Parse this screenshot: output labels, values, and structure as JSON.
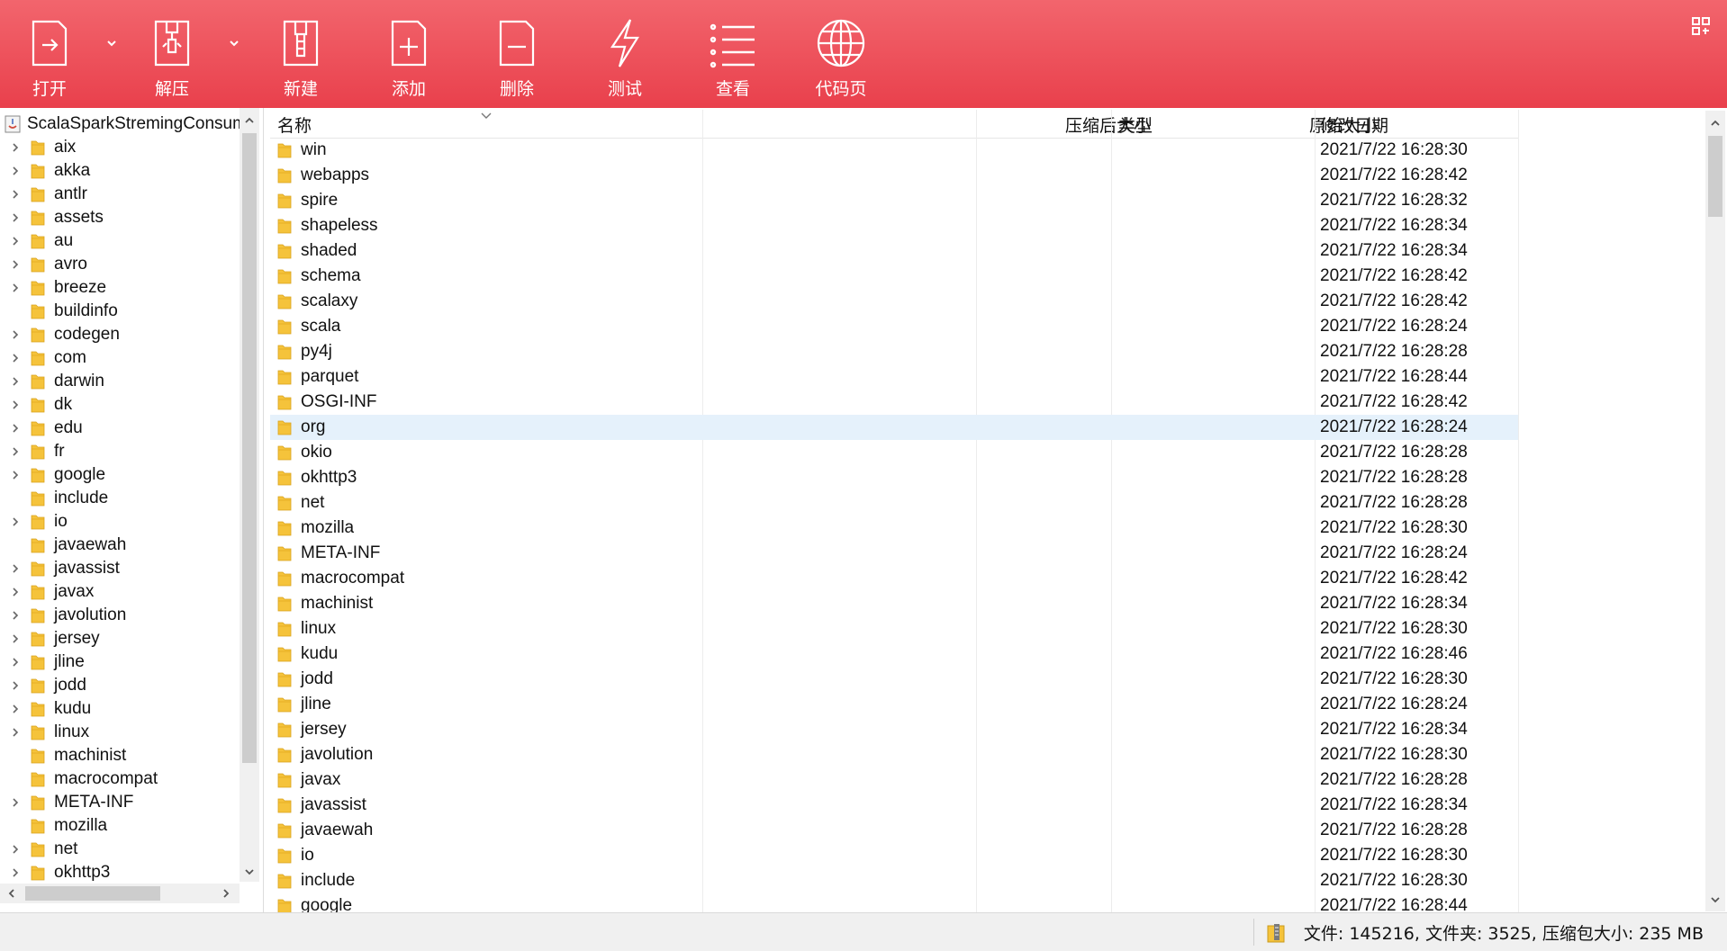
{
  "toolbar": {
    "buttons": [
      {
        "label": "打开",
        "icon": "open-icon"
      },
      {
        "label": "解压",
        "icon": "extract-icon"
      },
      {
        "label": "新建",
        "icon": "new-archive-icon"
      },
      {
        "label": "添加",
        "icon": "add-file-icon"
      },
      {
        "label": "删除",
        "icon": "delete-file-icon"
      },
      {
        "label": "测试",
        "icon": "test-icon"
      },
      {
        "label": "查看",
        "icon": "view-list-icon"
      },
      {
        "label": "代码页",
        "icon": "codepage-globe-icon"
      }
    ],
    "colors": {
      "gradient_top": "#f2656d",
      "gradient_bottom": "#e9404c"
    }
  },
  "tree": {
    "root_label": "ScalaSparkStremingConsumer",
    "items": [
      {
        "label": "aix",
        "expandable": true
      },
      {
        "label": "akka",
        "expandable": true
      },
      {
        "label": "antlr",
        "expandable": true
      },
      {
        "label": "assets",
        "expandable": true
      },
      {
        "label": "au",
        "expandable": true
      },
      {
        "label": "avro",
        "expandable": true
      },
      {
        "label": "breeze",
        "expandable": true
      },
      {
        "label": "buildinfo",
        "expandable": false
      },
      {
        "label": "codegen",
        "expandable": true
      },
      {
        "label": "com",
        "expandable": true
      },
      {
        "label": "darwin",
        "expandable": true
      },
      {
        "label": "dk",
        "expandable": true
      },
      {
        "label": "edu",
        "expandable": true
      },
      {
        "label": "fr",
        "expandable": true
      },
      {
        "label": "google",
        "expandable": true
      },
      {
        "label": "include",
        "expandable": false
      },
      {
        "label": "io",
        "expandable": true
      },
      {
        "label": "javaewah",
        "expandable": false
      },
      {
        "label": "javassist",
        "expandable": true
      },
      {
        "label": "javax",
        "expandable": true
      },
      {
        "label": "javolution",
        "expandable": true
      },
      {
        "label": "jersey",
        "expandable": true
      },
      {
        "label": "jline",
        "expandable": true
      },
      {
        "label": "jodd",
        "expandable": true
      },
      {
        "label": "kudu",
        "expandable": true
      },
      {
        "label": "linux",
        "expandable": true
      },
      {
        "label": "machinist",
        "expandable": false
      },
      {
        "label": "macrocompat",
        "expandable": false
      },
      {
        "label": "META-INF",
        "expandable": true
      },
      {
        "label": "mozilla",
        "expandable": false
      },
      {
        "label": "net",
        "expandable": true
      },
      {
        "label": "okhttp3",
        "expandable": true
      }
    ]
  },
  "list": {
    "columns": {
      "name": "名称",
      "packed_size": "压缩后大小",
      "original_size": "原始大小",
      "type": "类型",
      "modified": "修改日期"
    },
    "selected_row": 11,
    "rows": [
      {
        "name": "win",
        "modified": "2021/7/22 16:28:30"
      },
      {
        "name": "webapps",
        "modified": "2021/7/22 16:28:42"
      },
      {
        "name": "spire",
        "modified": "2021/7/22 16:28:32"
      },
      {
        "name": "shapeless",
        "modified": "2021/7/22 16:28:34"
      },
      {
        "name": "shaded",
        "modified": "2021/7/22 16:28:34"
      },
      {
        "name": "schema",
        "modified": "2021/7/22 16:28:42"
      },
      {
        "name": "scalaxy",
        "modified": "2021/7/22 16:28:42"
      },
      {
        "name": "scala",
        "modified": "2021/7/22 16:28:24"
      },
      {
        "name": "py4j",
        "modified": "2021/7/22 16:28:28"
      },
      {
        "name": "parquet",
        "modified": "2021/7/22 16:28:44"
      },
      {
        "name": "OSGI-INF",
        "modified": "2021/7/22 16:28:42"
      },
      {
        "name": "org",
        "modified": "2021/7/22 16:28:24"
      },
      {
        "name": "okio",
        "modified": "2021/7/22 16:28:28"
      },
      {
        "name": "okhttp3",
        "modified": "2021/7/22 16:28:28"
      },
      {
        "name": "net",
        "modified": "2021/7/22 16:28:28"
      },
      {
        "name": "mozilla",
        "modified": "2021/7/22 16:28:30"
      },
      {
        "name": "META-INF",
        "modified": "2021/7/22 16:28:24"
      },
      {
        "name": "macrocompat",
        "modified": "2021/7/22 16:28:42"
      },
      {
        "name": "machinist",
        "modified": "2021/7/22 16:28:34"
      },
      {
        "name": "linux",
        "modified": "2021/7/22 16:28:30"
      },
      {
        "name": "kudu",
        "modified": "2021/7/22 16:28:46"
      },
      {
        "name": "jodd",
        "modified": "2021/7/22 16:28:30"
      },
      {
        "name": "jline",
        "modified": "2021/7/22 16:28:24"
      },
      {
        "name": "jersey",
        "modified": "2021/7/22 16:28:34"
      },
      {
        "name": "javolution",
        "modified": "2021/7/22 16:28:30"
      },
      {
        "name": "javax",
        "modified": "2021/7/22 16:28:28"
      },
      {
        "name": "javassist",
        "modified": "2021/7/22 16:28:34"
      },
      {
        "name": "javaewah",
        "modified": "2021/7/22 16:28:28"
      },
      {
        "name": "io",
        "modified": "2021/7/22 16:28:30"
      },
      {
        "name": "include",
        "modified": "2021/7/22 16:28:30"
      },
      {
        "name": "google",
        "modified": "2021/7/22 16:28:44"
      }
    ]
  },
  "status": {
    "text": "文件: 145216, 文件夹: 3525, 压缩包大小: 235 MB"
  },
  "colors": {
    "folder": "#f5c33b",
    "selection": "#e5f1fb"
  }
}
